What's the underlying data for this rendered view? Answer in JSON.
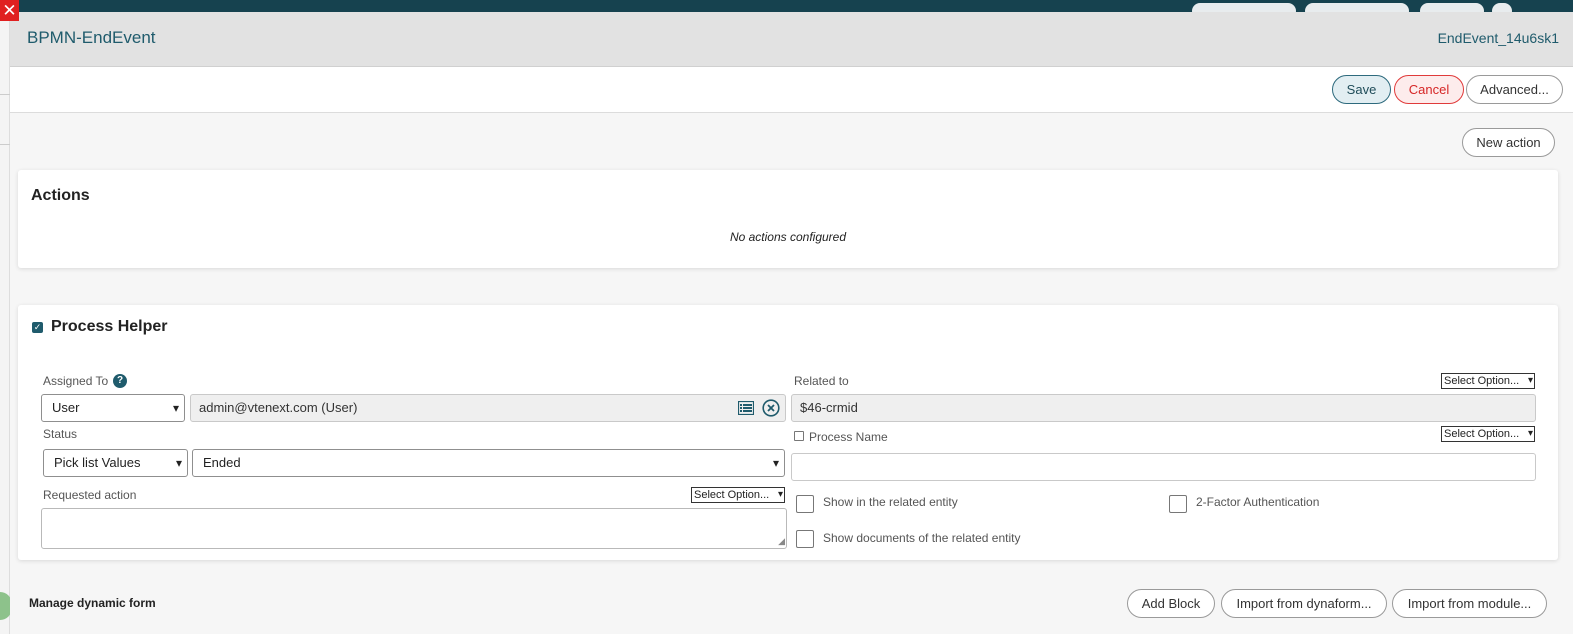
{
  "dialog": {
    "title": "BPMN-EndEvent",
    "element_id": "EndEvent_14u6sk1",
    "close_glyph": "✕"
  },
  "toolbar": {
    "save_label": "Save",
    "cancel_label": "Cancel",
    "advanced_label": "Advanced..."
  },
  "actions": {
    "new_action_label": "New action",
    "title": "Actions",
    "empty_message": "No actions configured"
  },
  "helper": {
    "title": "Process Helper",
    "enabled": true,
    "assigned_to": {
      "label": "Assigned To",
      "type_value": "User",
      "value": "admin@vtenext.com (User)"
    },
    "related_to": {
      "label": "Related to",
      "option_select": "Select Option...",
      "value": "$46-crmid"
    },
    "status": {
      "label": "Status",
      "type_value": "Pick list Values",
      "value": "Ended"
    },
    "process_name": {
      "label": "Process Name",
      "option_select": "Select Option...",
      "value": ""
    },
    "requested_action": {
      "label": "Requested action",
      "option_select": "Select Option...",
      "value": ""
    },
    "options": {
      "show_related_entity": "Show in the related entity",
      "two_factor": "2-Factor Authentication",
      "show_documents": "Show documents of the related entity"
    }
  },
  "dynamic_form": {
    "title": "Manage dynamic form",
    "add_block_label": "Add Block",
    "import_dynaform_label": "Import from dynaform...",
    "import_module_label": "Import from module..."
  },
  "colors": {
    "accent": "#1f5b6c",
    "danger": "#d62626",
    "header_bg": "#e2e2e2"
  }
}
